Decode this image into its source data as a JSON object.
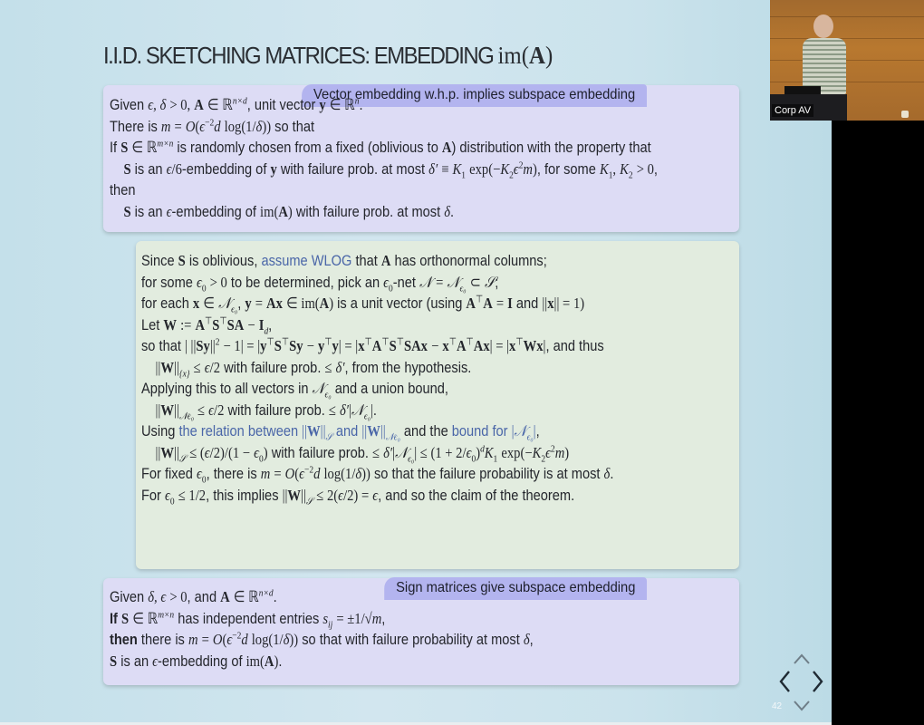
{
  "slide": {
    "title_text": "I.I.D. SKETCHING MATRICES: EMBEDDING ",
    "title_math": "im(A)",
    "page_number": "42"
  },
  "theorem_box": {
    "tag": "Vector embedding w.h.p. implies subspace embedding",
    "lines": [
      "Given ϵ, δ > 0, A ∈ ℝⁿˣᵈ, unit vector y ∈ ℝⁿ.",
      "There is m = O(ϵ⁻²d log(1/δ)) so that",
      "If S ∈ ℝᵐˣⁿ is randomly chosen from a fixed (oblivious to A) distribution with the property that",
      "S is an ϵ/6-embedding of y with failure prob. at most δ′ ≡ K₁ exp(−K₂ϵ²m), for some K₁, K₂ > 0,",
      "then",
      "S is an ϵ-embedding of im(A) with failure prob. at most δ."
    ]
  },
  "proof_box": {
    "links": {
      "assume_wlog": "assume WLOG",
      "relation": "the relation between ||W||𝒮 and ||W||𝒩ϵ₀",
      "bound": "bound for |𝒩ϵ₀|"
    },
    "lines": [
      "Since S is oblivious, assume WLOG that A has orthonormal columns;",
      "for some ϵ₀ > 0 to be determined, pick an ϵ₀-net 𝒩 = 𝒩ϵ₀ ⊂ 𝒮;",
      "for each x ∈ 𝒩ϵ₀, y = Ax ∈ im(A) is a unit vector (using AᵀA = I and ||x|| = 1)",
      "Let W := AᵀSᵀSA − I_d,",
      "so that | ||Sy||² − 1| = |yᵀSᵀSy − yᵀy| = |xᵀAᵀSᵀSAx − xᵀAᵀAx| = |xᵀWx|, and thus",
      "||W||{x} ≤ ϵ/2 with failure prob. ≤ δ′, from the hypothesis.",
      "Applying this to all vectors in 𝒩ϵ₀ and a union bound,",
      "||W||𝒩ϵ₀ ≤ ϵ/2 with failure prob. ≤ δ′|𝒩ϵ₀|.",
      "Using the relation between ||W||𝒮 and ||W||𝒩ϵ₀ and the bound for |𝒩ϵ₀|,",
      "||W||𝒮 ≤ (ϵ/2)/(1 − ϵ₀) with failure prob. ≤ δ′|𝒩ϵ₀| ≤ (1 + 2/ϵ₀)ᵈ K₁ exp(−K₂ϵ²m)",
      "For fixed ϵ₀, there is m = O(ϵ⁻²d log(1/δ)) so that the failure probability is at most δ.",
      "For ϵ₀ ≤ 1/2, this implies ||W||𝒮 ≤ 2(ϵ/2) = ϵ, and so the claim of the theorem."
    ]
  },
  "sign_box": {
    "tag": "Sign matrices give subspace embedding",
    "lines": [
      "Given δ, ϵ > 0, and A ∈ ℝⁿˣᵈ.",
      "If S ∈ ℝᵐˣⁿ has independent entries sᵢⱼ = ±1/√m,",
      "then there is m = O(ϵ⁻²d log(1/δ)) so that with failure probability at most δ,",
      "S is an ϵ-embedding of im(A)."
    ],
    "keywords": {
      "if": "If",
      "then": "then"
    }
  },
  "video_overlay": {
    "label": "Corp AV"
  },
  "navigation": {
    "up_icon": "chevron-up-icon",
    "left_icon": "chevron-left-icon",
    "right_icon": "chevron-right-icon",
    "down_icon": "chevron-down-icon"
  },
  "colors": {
    "background": "#c8e2ec",
    "theorem_box": "#dddcf5",
    "proof_box": "#e2ecdf",
    "tag": "#b3b4ef",
    "link": "#4a66a8",
    "text": "#24262c"
  }
}
